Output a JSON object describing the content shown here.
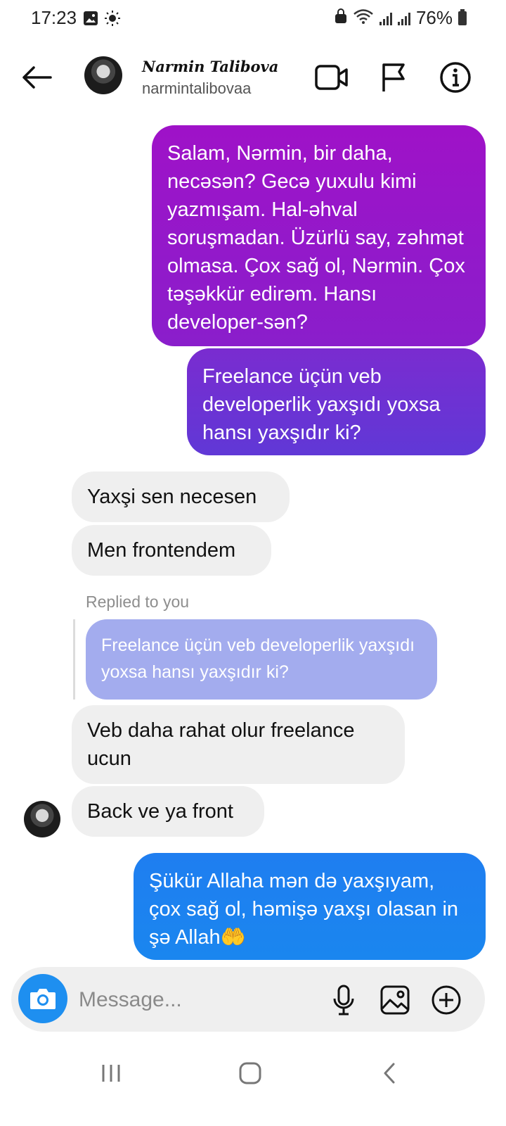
{
  "status_bar": {
    "time": "17:23",
    "battery": "76%",
    "left_icons": [
      "image-icon",
      "sun-icon"
    ],
    "right_icons": [
      "lock-icon",
      "wifi-icon",
      "signal-icon",
      "signal-icon",
      "battery-icon"
    ]
  },
  "header": {
    "name": "Narmin Talibova",
    "username": "narmintalibovaa",
    "actions": [
      "video-call-icon",
      "flag-icon",
      "info-icon"
    ]
  },
  "messages": [
    {
      "side": "out",
      "text": "Salam, Nərmin, bir daha, necəsən? Gecə yuxulu kimi yazmışam. Hal-əhval soruşmadan. Üzürlü say, zəhmət olmasa. Çox sağ ol, Nərmin. Çox təşəkkür edirəm. Hansı developer-sən?"
    },
    {
      "side": "out",
      "text": "Freelance üçün veb developerlik yaxşıdı yoxsa hansı yaxşıdır ki?"
    },
    {
      "side": "in",
      "text": "Yaxşi sen necesen"
    },
    {
      "side": "in",
      "text": "Men frontendem"
    },
    {
      "side": "in",
      "text": "Veb daha rahat olur freelance ucun"
    },
    {
      "side": "in",
      "text": "Back ve ya front"
    },
    {
      "side": "out",
      "text": "Şükür Allaha mən də yaxşıyam, çox sağ ol, həmişə yaxşı olasan in şə Allah🤲"
    }
  ],
  "reply": {
    "label": "Replied to you",
    "quoted": "Freelance üçün veb developerlik yaxşıdı yoxsa hansı yaxşıdır ki?"
  },
  "composer": {
    "placeholder": "Message...",
    "icons": [
      "camera-icon",
      "microphone-icon",
      "gallery-icon",
      "add-icon"
    ]
  },
  "colors": {
    "bubble_purple": "#9a16c4",
    "bubble_violet": "#6b36d4",
    "bubble_blue": "#1a7ff0",
    "incoming_bg": "#efefef",
    "reply_bg": "#a3acee",
    "camera_button": "#1e8ff0"
  },
  "nav_bar": [
    "recent-apps-icon",
    "home-icon",
    "back-icon"
  ]
}
